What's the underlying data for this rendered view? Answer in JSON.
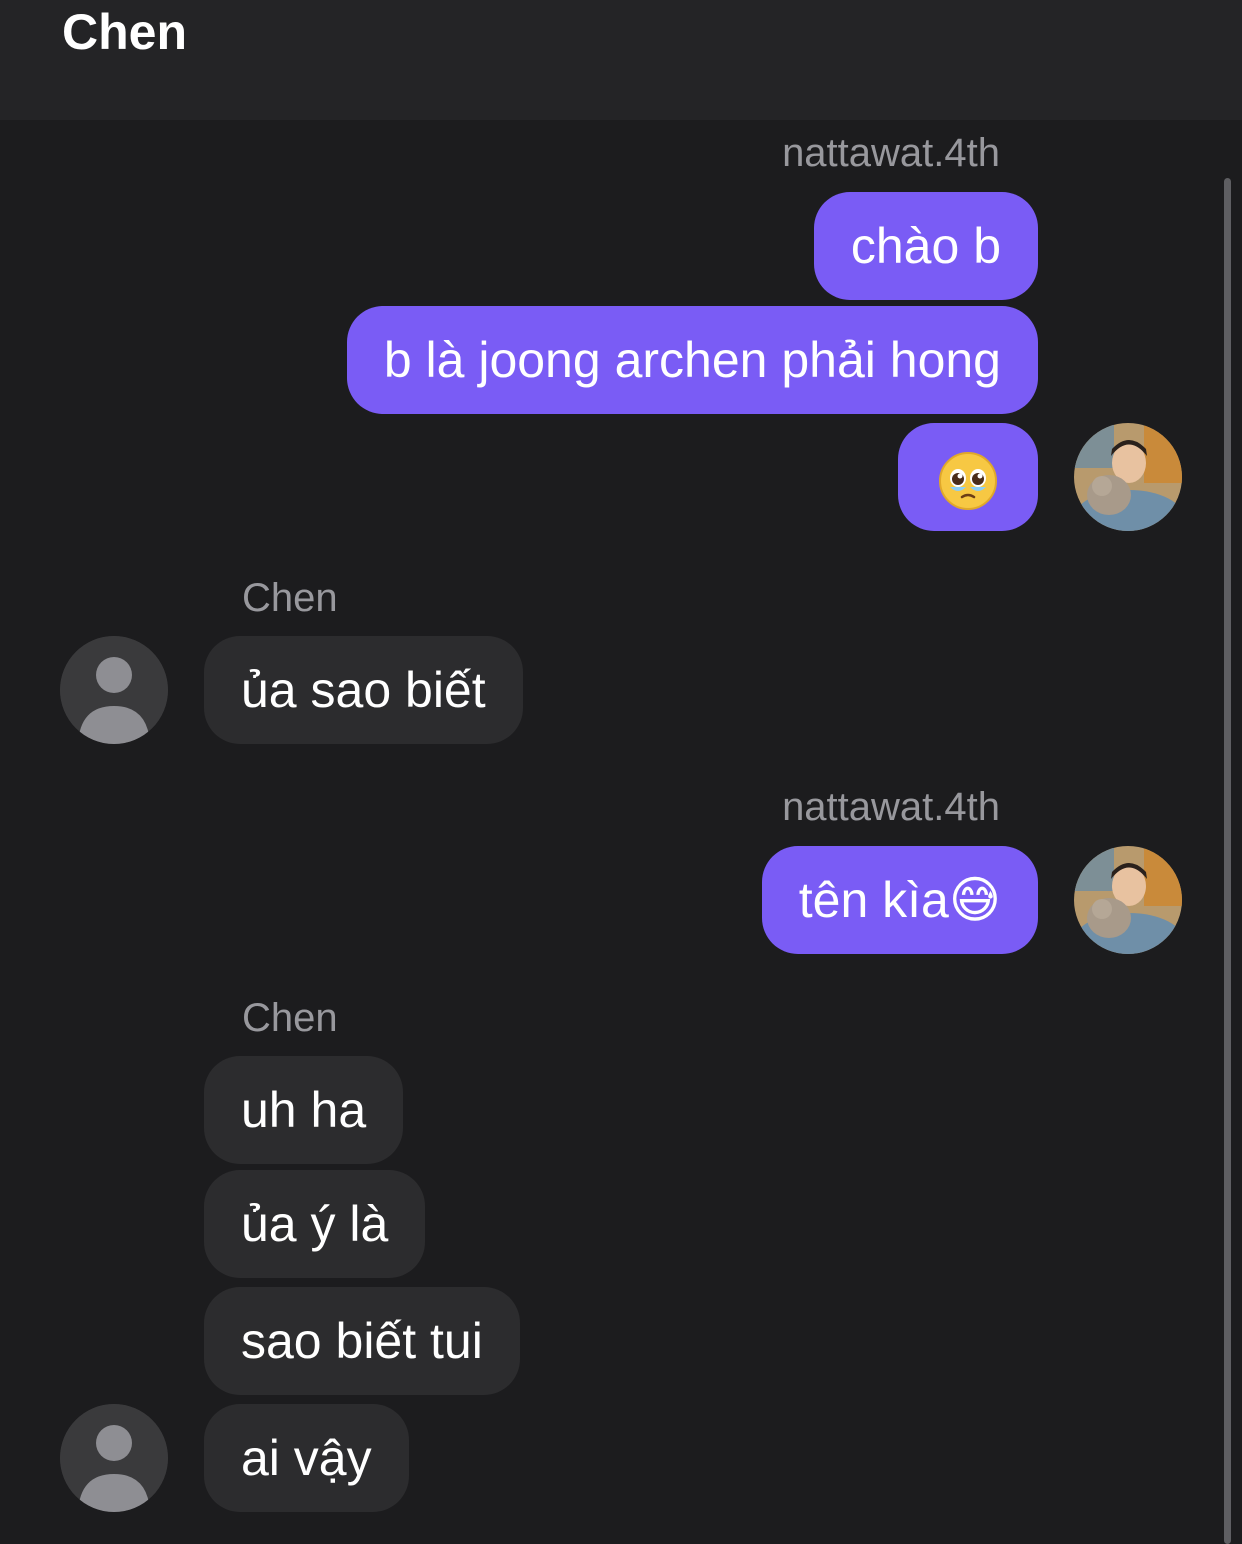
{
  "header": {
    "title": "Chen"
  },
  "messages": [
    {
      "sender": "nattawat.4th",
      "text": "chào b"
    },
    {
      "text": "b là joong archen phải hong"
    },
    {
      "text": "🥹"
    },
    {
      "sender": "Chen",
      "text": "ủa sao biết"
    },
    {
      "sender": "nattawat.4th",
      "text": "tên kìa😅"
    },
    {
      "sender": "Chen",
      "text": "uh ha"
    },
    {
      "text": "ủa ý là"
    },
    {
      "text": "sao biết tui"
    },
    {
      "text": "ai vậy"
    }
  ],
  "colors": {
    "background": "#1c1c1e",
    "header": "#242426",
    "outgoing_bubble": "#7a5cf5",
    "incoming_bubble": "#2c2c2e",
    "sender_name": "#98989d"
  }
}
